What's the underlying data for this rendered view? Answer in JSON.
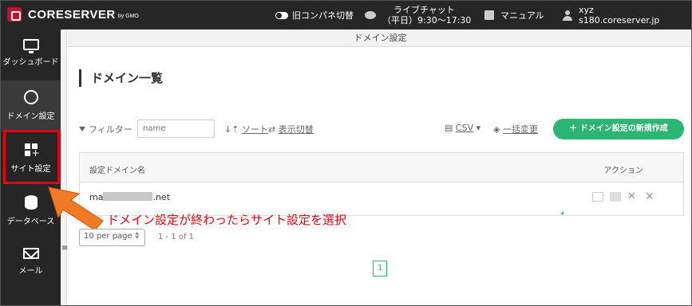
{
  "header": {
    "brand": "CORESERVER",
    "brand_sub": "by GMO",
    "legacy_toggle": "旧コンパネ切替",
    "chat_title": "ライブチャット",
    "chat_hours": "（平日）9:30〜17:30",
    "manual": "マニュアル",
    "user_name": "xyz",
    "user_host": "s180.coreserver.jp"
  },
  "sidebar": {
    "items": [
      {
        "label": "ダッシュボード",
        "icon": "monitor-icon"
      },
      {
        "label": "ドメイン設定",
        "icon": "globe-www-icon"
      },
      {
        "label": "サイト設定",
        "icon": "grid-plus-icon"
      },
      {
        "label": "データベース",
        "icon": "database-icon"
      },
      {
        "label": "メール",
        "icon": "mail-icon"
      }
    ],
    "active_index": 1,
    "highlighted_index": 2
  },
  "subheader": "ドメイン設定",
  "page_title": "ドメイン一覧",
  "toolbar": {
    "filter_label": "フィルター",
    "filter_placeholder": "name",
    "sort": "ソート",
    "toggle_view": "表示切替",
    "csv": "CSV",
    "bulk_change": "一括変更",
    "create_button": "ドメイン設定の新規作成"
  },
  "table": {
    "headers": {
      "name": "設定ドメイン名",
      "actions": "アクション"
    },
    "rows": [
      {
        "domain_prefix": "ma",
        "domain_suffix": ".net"
      }
    ]
  },
  "annotation": "ドメイン設定が終わったらサイト設定を選択",
  "pagination": {
    "per_page": "10 per page",
    "range": "1 - 1 of 1",
    "current_page": "1"
  },
  "colors": {
    "accent_green": "#2bb673",
    "annotation_red": "#e60012",
    "arrow_orange": "#f27a24",
    "topbar": "#262626"
  }
}
